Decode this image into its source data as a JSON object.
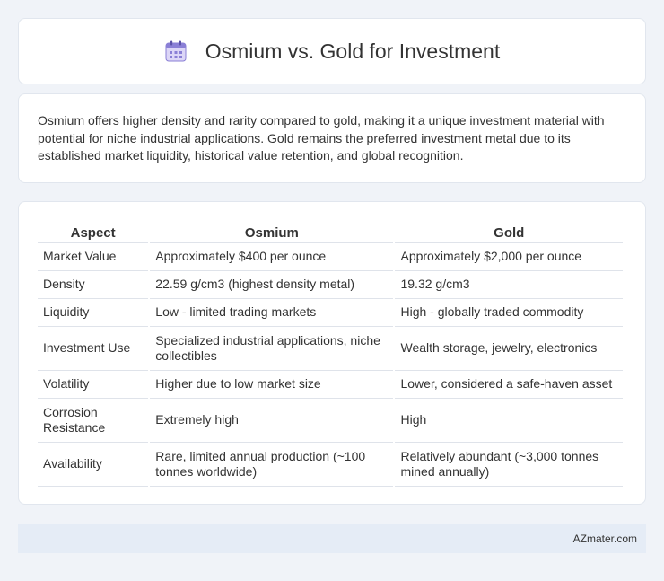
{
  "header": {
    "title": "Osmium vs. Gold for Investment",
    "icon": "calendar-icon"
  },
  "summary": {
    "text": "Osmium offers higher density and rarity compared to gold, making it a unique investment material with potential for niche industrial applications. Gold remains the preferred investment metal due to its established market liquidity, historical value retention, and global recognition."
  },
  "table": {
    "headers": [
      "Aspect",
      "Osmium",
      "Gold"
    ],
    "rows": [
      [
        "Market Value",
        "Approximately $400 per ounce",
        "Approximately $2,000 per ounce"
      ],
      [
        "Density",
        "22.59 g/cm3 (highest density metal)",
        "19.32 g/cm3"
      ],
      [
        "Liquidity",
        "Low - limited trading markets",
        "High - globally traded commodity"
      ],
      [
        "Investment Use",
        "Specialized industrial applications, niche collectibles",
        "Wealth storage, jewelry, electronics"
      ],
      [
        "Volatility",
        "Higher due to low market size",
        "Lower, considered a safe-haven asset"
      ],
      [
        "Corrosion Resistance",
        "Extremely high",
        "High"
      ],
      [
        "Availability",
        "Rare, limited annual production (~100 tonnes worldwide)",
        "Relatively abundant (~3,000 tonnes mined annually)"
      ]
    ]
  },
  "footer": {
    "text": "AZmater.com"
  }
}
